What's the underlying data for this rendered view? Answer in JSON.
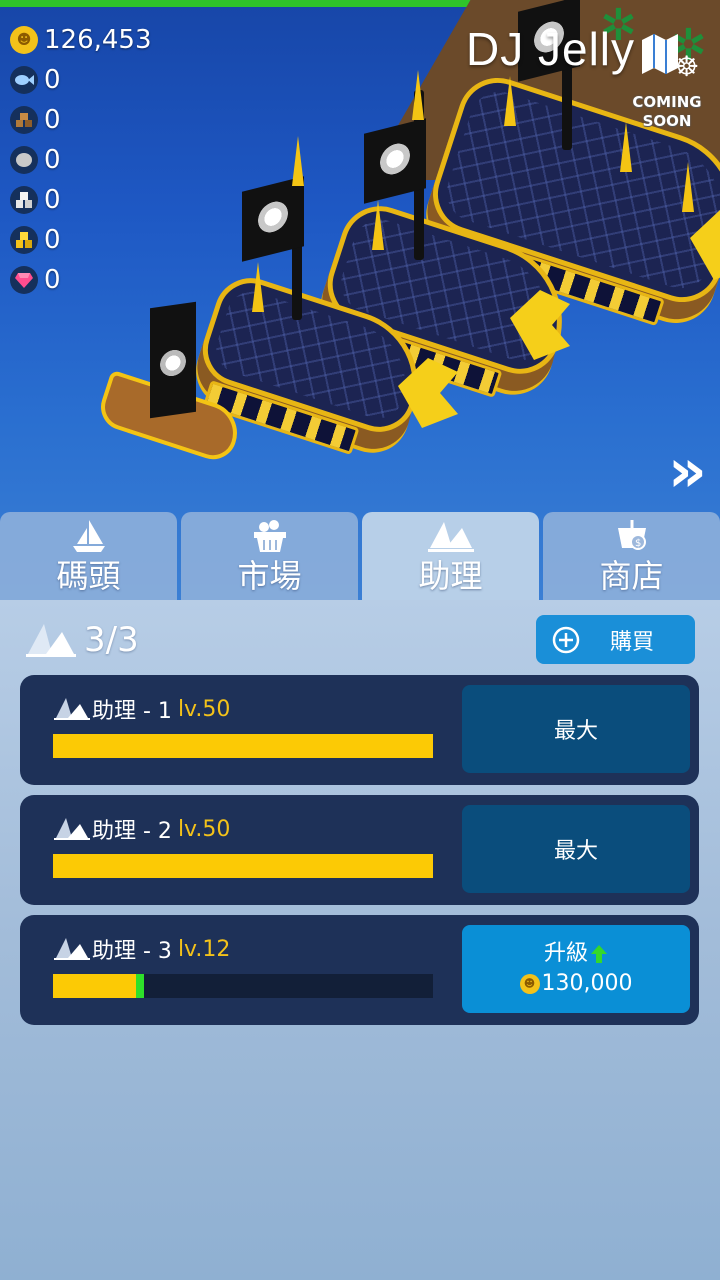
{
  "hud": {
    "title": "DJ Jelly",
    "coming_soon": [
      "COMING",
      "SOON"
    ],
    "resources": [
      {
        "icon": "coin-icon",
        "value": "126,453"
      },
      {
        "icon": "fish-icon",
        "value": "0"
      },
      {
        "icon": "wood-icon",
        "value": "0"
      },
      {
        "icon": "stone-icon",
        "value": "0"
      },
      {
        "icon": "iron-icon",
        "value": "0"
      },
      {
        "icon": "gold-icon",
        "value": "0"
      },
      {
        "icon": "gem-icon",
        "value": "0"
      }
    ],
    "next_arrow": "»"
  },
  "tabs": [
    {
      "label": "碼頭",
      "icon": "sailboat-icon",
      "active": false
    },
    {
      "label": "市場",
      "icon": "basket-icon",
      "active": false
    },
    {
      "label": "助理",
      "icon": "twin-sails-icon",
      "active": true
    },
    {
      "label": "商店",
      "icon": "shop-cart-icon",
      "active": false
    }
  ],
  "panel": {
    "count": "3/3",
    "buy_label": "購買",
    "assistants": [
      {
        "name": "助理 - 1",
        "level": "lv.50",
        "progress": 1.0,
        "action": "最大",
        "maxed": true
      },
      {
        "name": "助理 - 2",
        "level": "lv.50",
        "progress": 1.0,
        "action": "最大",
        "maxed": true
      },
      {
        "name": "助理 - 3",
        "level": "lv.12",
        "progress": 0.24,
        "action": "升級",
        "cost": "130,000",
        "maxed": false
      }
    ]
  },
  "colors": {
    "accent": "#1a8fd8",
    "card": "#1e3158",
    "bar_fill": "#fcca05",
    "level_text": "#f3c21a",
    "max_button": "#0a4d7c",
    "upgrade_button": "#0a8fd6"
  }
}
